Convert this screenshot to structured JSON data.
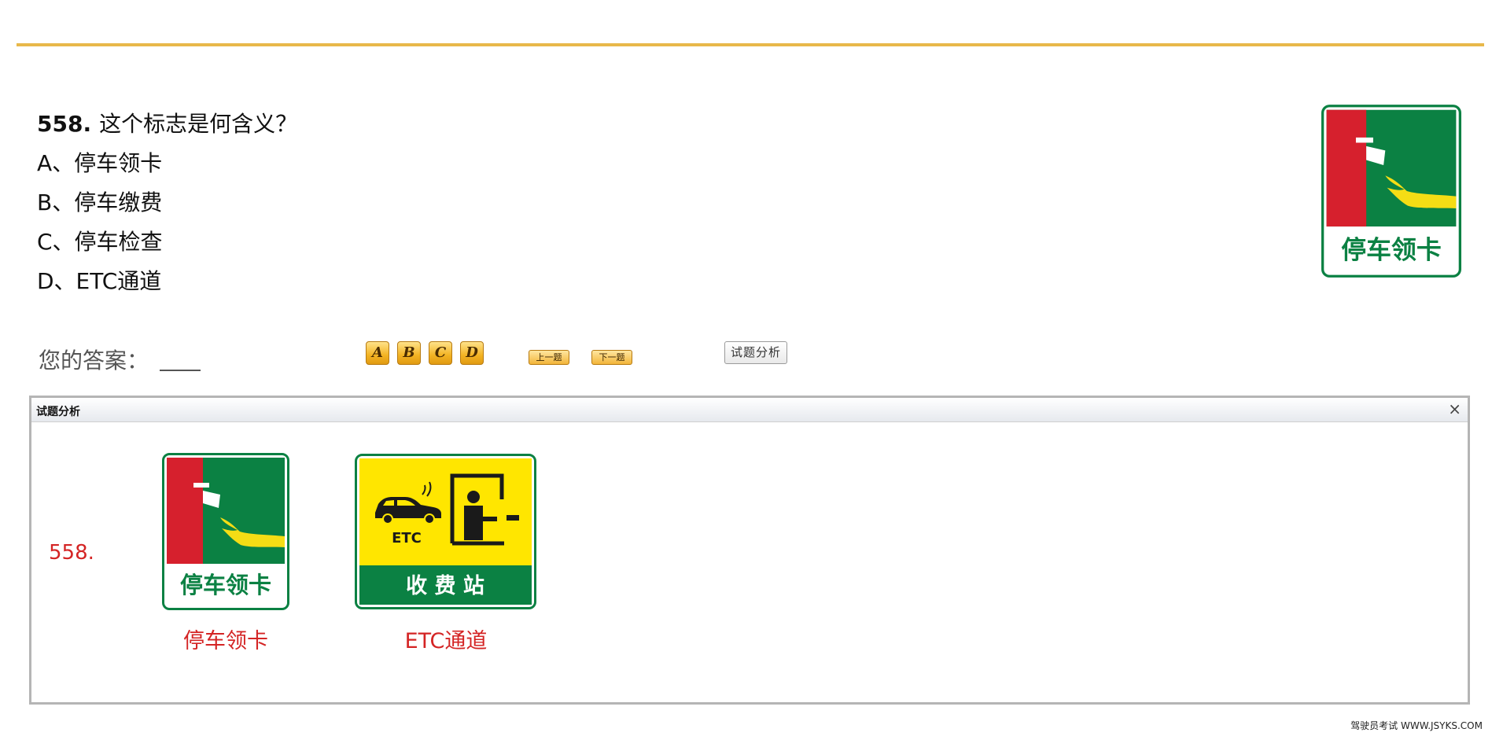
{
  "question": {
    "number": "558.",
    "text": "这个标志是何含义？",
    "options": [
      {
        "label": "A、停车领卡"
      },
      {
        "label": "B、停车缴费"
      },
      {
        "label": "C、停车检查"
      },
      {
        "label": "D、ETC通道"
      }
    ],
    "sign_text": "停车领卡"
  },
  "answer": {
    "label": "您的答案：",
    "value": ""
  },
  "controls": {
    "option_buttons": [
      "A",
      "B",
      "C",
      "D"
    ],
    "prev_label": "上一题",
    "next_label": "下一题",
    "analysis_label": "试题分析"
  },
  "analysis_panel": {
    "title": "试题分析",
    "close_glyph": "×",
    "number": "558.",
    "signs": [
      {
        "sign_text": "停车领卡",
        "caption": "停车领卡"
      },
      {
        "sign_text": "收 费 站",
        "etc_text": "ETC",
        "caption": "ETC通道"
      }
    ]
  },
  "footer": {
    "text": "驾驶员考试 WWW.JSYKS.COM"
  },
  "colors": {
    "accent_line": "#e8b84a",
    "sign_green": "#0b8143",
    "sign_red": "#d6202d",
    "sign_yellow": "#ffe600",
    "caption_red": "#d42424"
  }
}
